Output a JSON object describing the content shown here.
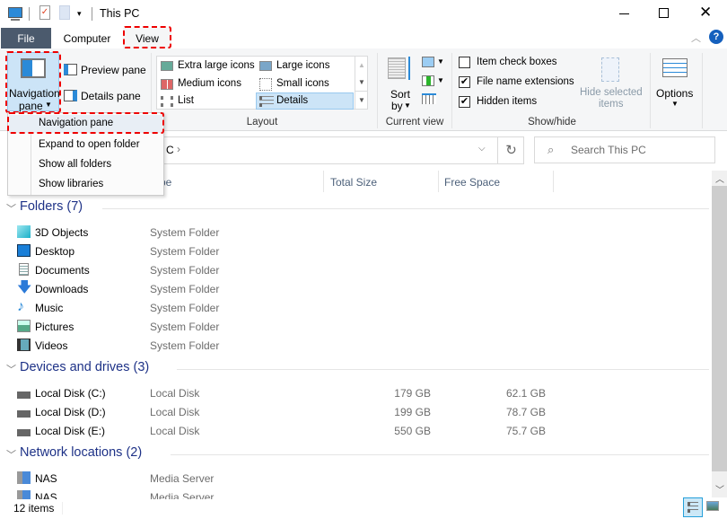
{
  "window": {
    "title": "This PC",
    "minimize_icon": "minimize-icon",
    "maximize_icon": "maximize-icon",
    "close_icon": "close-icon"
  },
  "tabs": [
    {
      "label": "File"
    },
    {
      "label": "Computer"
    },
    {
      "label": "View"
    }
  ],
  "ribbon": {
    "panes": {
      "navigation_pane": "Navigation",
      "navigation_pane2": "pane",
      "preview_pane": "Preview pane",
      "details_pane": "Details pane"
    },
    "layout": {
      "label": "Layout",
      "items": [
        "Extra large icons",
        "Large icons",
        "Medium icons",
        "Small icons",
        "List",
        "Details"
      ],
      "selected": "Details"
    },
    "current_view": {
      "label": "Current view",
      "sort_by": "Sort",
      "sort_by2": "by"
    },
    "show_hide": {
      "label": "Show/hide",
      "item_check_boxes": {
        "label": "Item check boxes",
        "checked": false
      },
      "file_name_extensions": {
        "label": "File name extensions",
        "checked": true
      },
      "hidden_items": {
        "label": "Hidden items",
        "checked": true
      },
      "hide_selected": "Hide selected",
      "hide_selected2": "items"
    },
    "options": "Options"
  },
  "nav_menu": {
    "items": [
      "Navigation pane",
      "Expand to open folder",
      "Show all folders",
      "Show libraries"
    ]
  },
  "address": {
    "fragment": "C",
    "search_placeholder": "Search This PC"
  },
  "columns": {
    "type_fragment": "pe",
    "total_size": "Total Size",
    "free_space": "Free Space"
  },
  "groups": [
    {
      "title": "Folders (7)",
      "items": [
        {
          "name": "3D Objects",
          "type": "System Folder",
          "icon": "3d-objects-icon"
        },
        {
          "name": "Desktop",
          "type": "System Folder",
          "icon": "desktop-icon"
        },
        {
          "name": "Documents",
          "type": "System Folder",
          "icon": "documents-icon"
        },
        {
          "name": "Downloads",
          "type": "System Folder",
          "icon": "downloads-icon"
        },
        {
          "name": "Music",
          "type": "System Folder",
          "icon": "music-icon"
        },
        {
          "name": "Pictures",
          "type": "System Folder",
          "icon": "pictures-icon"
        },
        {
          "name": "Videos",
          "type": "System Folder",
          "icon": "videos-icon"
        }
      ]
    },
    {
      "title": "Devices and drives (3)",
      "items": [
        {
          "name": "Local Disk (C:)",
          "type": "Local Disk",
          "total": "179 GB",
          "free": "62.1 GB",
          "icon": "drive-icon"
        },
        {
          "name": "Local Disk (D:)",
          "type": "Local Disk",
          "total": "199 GB",
          "free": "78.7 GB",
          "icon": "drive-icon"
        },
        {
          "name": "Local Disk (E:)",
          "type": "Local Disk",
          "total": "550 GB",
          "free": "75.7 GB",
          "icon": "drive-icon"
        }
      ]
    },
    {
      "title": "Network locations (2)",
      "items": [
        {
          "name": "NAS",
          "type": "Media Server",
          "icon": "media-server-icon"
        },
        {
          "name": "NAS",
          "type": "Media Server",
          "icon": "media-server-icon"
        }
      ]
    }
  ],
  "status": {
    "count": "12 items"
  },
  "colors": {
    "file_tab": "#4b5a6d",
    "accent": "#1e3287",
    "highlight": "#cce4f7",
    "dash": "#e00000"
  }
}
